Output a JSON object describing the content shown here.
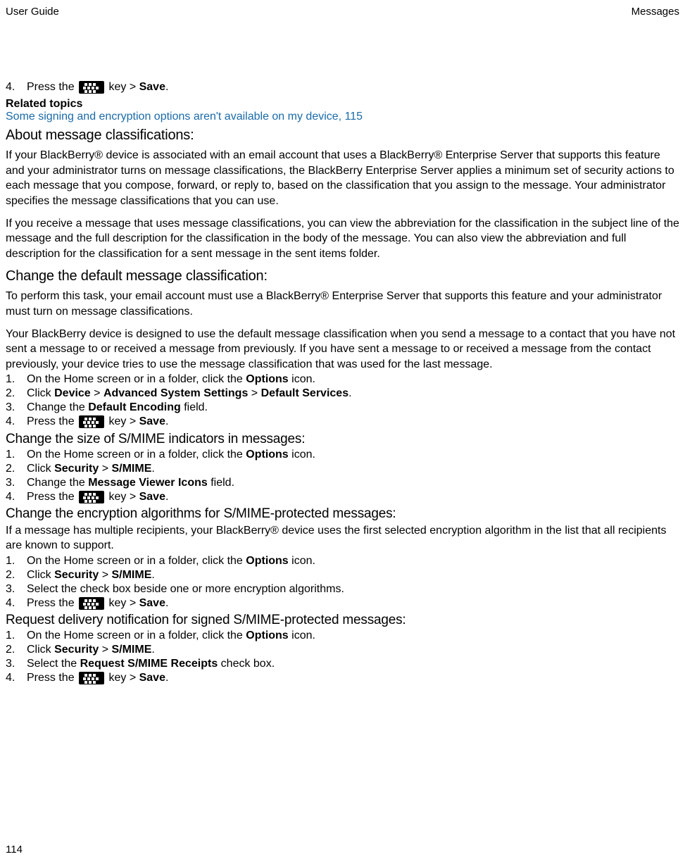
{
  "header": {
    "left": "User Guide",
    "right": "Messages"
  },
  "footer": {
    "page": "114"
  },
  "step4": {
    "num": "4.",
    "pre": "Press the ",
    "post": " key > ",
    "save": "Save",
    "dot": "."
  },
  "related": {
    "heading": "Related topics",
    "link": "Some signing and encryption options aren't available on my device, 115"
  },
  "about": {
    "title": "About message classifications:",
    "p1": "If your BlackBerry® device is associated with an email account that uses a BlackBerry® Enterprise Server that supports this feature and your administrator turns on message classifications, the BlackBerry Enterprise Server applies a minimum set of security actions to each message that you compose, forward, or reply to, based on the classification that you assign to the message. Your administrator specifies the message classifications that you can use.",
    "p2": "If you receive a message that uses message classifications, you can view the abbreviation for the classification in the subject line of the message and the full description for the classification in the body of the message. You can also view the abbreviation and full description for the classification for a sent message in the sent items folder."
  },
  "changeDefault": {
    "title": "Change the default message classification:",
    "p1": "To perform this task, your email account must use a BlackBerry® Enterprise Server that supports this feature and your administrator must turn on message classifications.",
    "p2": "Your BlackBerry device is designed to use the default message classification when you send a message to a contact that you have not sent a message to or received a message from previously. If you have sent a message to or received a message from the contact previously, your device tries to use the message classification that was used for the last message.",
    "s1": {
      "n": "1.",
      "a": "On the Home screen or in a folder, click the ",
      "b": "Options",
      "c": " icon."
    },
    "s2": {
      "n": "2.",
      "a": "Click ",
      "b": "Device",
      "c": " > ",
      "d": "Advanced System Settings",
      "e": " > ",
      "f": "Default Services",
      "g": "."
    },
    "s3": {
      "n": "3.",
      "a": "Change the ",
      "b": "Default Encoding",
      "c": " field."
    },
    "s4": {
      "n": "4.",
      "a": "Press the ",
      "b": " key > ",
      "c": "Save",
      "d": "."
    }
  },
  "changeSize": {
    "title": "Change the size of S/MIME indicators in messages:",
    "s1": {
      "n": "1.",
      "a": "On the Home screen or in a folder, click the ",
      "b": "Options",
      "c": " icon."
    },
    "s2": {
      "n": "2.",
      "a": "Click ",
      "b": "Security",
      "c": " > ",
      "d": "S/MIME",
      "e": "."
    },
    "s3": {
      "n": "3.",
      "a": "Change the ",
      "b": "Message Viewer Icons",
      "c": " field."
    },
    "s4": {
      "n": "4.",
      "a": "Press the ",
      "b": " key > ",
      "c": "Save",
      "d": "."
    }
  },
  "changeEnc": {
    "title": "Change the encryption algorithms for S/MIME-protected messages:",
    "p1": "If a message has multiple recipients, your BlackBerry® device uses the first selected encryption algorithm in the list that all recipients are known to support.",
    "s1": {
      "n": "1.",
      "a": "On the Home screen or in a folder, click the ",
      "b": "Options",
      "c": " icon."
    },
    "s2": {
      "n": "2.",
      "a": "Click ",
      "b": "Security",
      "c": " > ",
      "d": "S/MIME",
      "e": "."
    },
    "s3": {
      "n": "3.",
      "a": "Select the check box beside one or more encryption algorithms."
    },
    "s4": {
      "n": "4.",
      "a": "Press the ",
      "b": " key > ",
      "c": "Save",
      "d": "."
    }
  },
  "request": {
    "title": "Request delivery notification for signed S/MIME-protected messages:",
    "s1": {
      "n": "1.",
      "a": "On the Home screen or in a folder, click the ",
      "b": "Options",
      "c": " icon."
    },
    "s2": {
      "n": "2.",
      "a": "Click ",
      "b": "Security",
      "c": " > ",
      "d": "S/MIME",
      "e": "."
    },
    "s3": {
      "n": "3.",
      "a": "Select the ",
      "b": "Request S/MIME Receipts",
      "c": " check box."
    },
    "s4": {
      "n": "4.",
      "a": "Press the ",
      "b": " key > ",
      "c": "Save",
      "d": "."
    }
  }
}
